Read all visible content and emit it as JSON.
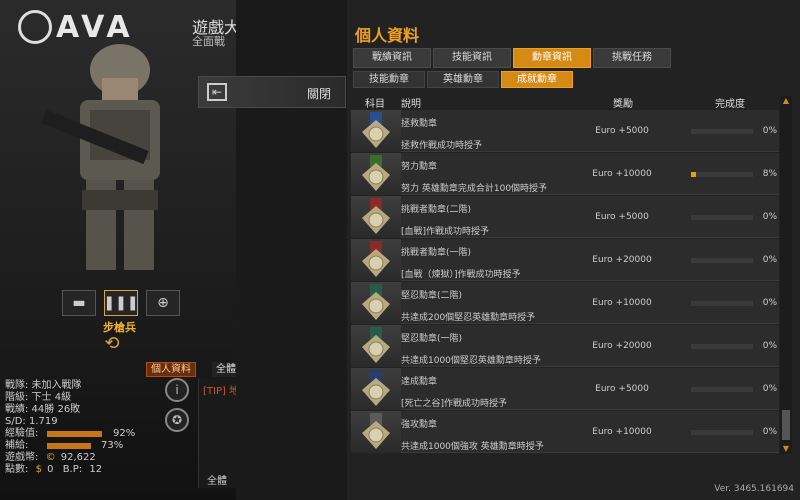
{
  "game": {
    "logo": "AVA",
    "mode_title": "遊戲大",
    "mode_sub": "全面戰"
  },
  "loadout": {
    "class_label": "步槍兵"
  },
  "close": {
    "label": "關閉"
  },
  "left_tabs": {
    "profile": "個人資料",
    "all_top": "全體"
  },
  "stats": {
    "team": "戰隊: 未加入戰隊",
    "rank": "階級: 下士 4級",
    "record": "戰績: 44勝 26敗",
    "sd": "S/D: 1.719",
    "exp_label": "經驗值:",
    "exp_pct": "92%",
    "exp_value": 0.92,
    "supply_label": "補給:",
    "supply_pct": "73%",
    "supply_value": 0.73,
    "money_label": "遊戲幣:",
    "money": "92,622",
    "points_label": "點數:",
    "points": "0",
    "bp_label": "B.P:",
    "bp": "12"
  },
  "tip": {
    "text": "[TIP] 地",
    "all": "全體"
  },
  "panel": {
    "title": "個人資料",
    "tabs": [
      "戰績資訊",
      "技能資訊",
      "勳章資訊",
      "挑戰任務"
    ],
    "subtabs": [
      "技能勳章",
      "英雄勳章",
      "成就勳章"
    ],
    "headers": {
      "item": "科目",
      "desc": "說明",
      "reward": "獎勵",
      "progress": "完成度"
    }
  },
  "medals": [
    {
      "name": "拯救勳章",
      "desc": "拯救作戰成功時授予",
      "reward": "Euro +5000",
      "pct": "0%",
      "progress": 0,
      "color": "#2a4d8f"
    },
    {
      "name": "努力勳章",
      "desc": "努力 英雄勳章完成合計100個時授予",
      "reward": "Euro +10000",
      "pct": "8%",
      "progress": 0.08,
      "color": "#3f6a2f"
    },
    {
      "name": "挑戰者勳章(二階)",
      "desc": "[血戰]作戰成功時授予",
      "reward": "Euro +5000",
      "pct": "0%",
      "progress": 0,
      "color": "#8a2a2a"
    },
    {
      "name": "挑戰者勳章(一階)",
      "desc": "[血戰（煉獄）]作戰成功時授予",
      "reward": "Euro +20000",
      "pct": "0%",
      "progress": 0,
      "color": "#8a2a2a"
    },
    {
      "name": "堅忍勳章(二階)",
      "desc": "共達成200個堅忍英雄勳章時授予",
      "reward": "Euro +10000",
      "pct": "0%",
      "progress": 0,
      "color": "#2a5a4a"
    },
    {
      "name": "堅忍勳章(一階)",
      "desc": "共達成1000個堅忍英雄勳章時授予",
      "reward": "Euro +20000",
      "pct": "0%",
      "progress": 0,
      "color": "#2a5a4a"
    },
    {
      "name": "達成勳章",
      "desc": "[死亡之谷]作戰成功時授予",
      "reward": "Euro +5000",
      "pct": "0%",
      "progress": 0,
      "color": "#2a3a6a"
    },
    {
      "name": "強攻勳章",
      "desc": "共達成1000個強攻 英雄勳章時授予",
      "reward": "Euro +10000",
      "pct": "0%",
      "progress": 0,
      "color": "#5a5a5a"
    }
  ],
  "version": "Ver. 3465.161694"
}
